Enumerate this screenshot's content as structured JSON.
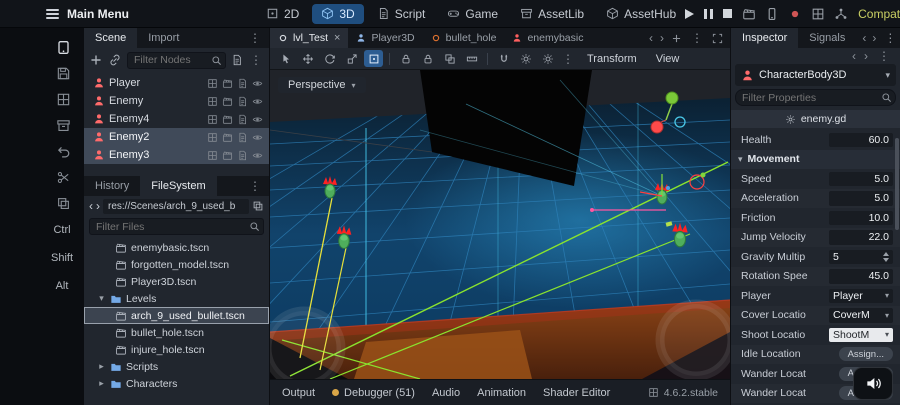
{
  "topbar": {
    "main_menu_label": "Main Menu",
    "workspaces": [
      {
        "label": "2D",
        "icon": "workspace-2d-icon",
        "active": false
      },
      {
        "label": "3D",
        "icon": "workspace-3d-icon",
        "active": true
      },
      {
        "label": "Script",
        "icon": "script-workspace-icon",
        "active": false
      },
      {
        "label": "Game",
        "icon": "gamepad-icon",
        "active": false
      },
      {
        "label": "AssetLib",
        "icon": "assetlib-icon",
        "active": false
      },
      {
        "label": "AssetHub",
        "icon": "assethub-icon",
        "active": false
      }
    ],
    "playback_icons": [
      "play-icon",
      "pause-icon",
      "stop-icon"
    ],
    "misc_icons": [
      "clapper-icon",
      "devices-icon",
      "remote-debug-icon",
      "grid-icon",
      "network-icon"
    ],
    "renderer": {
      "label": "Compatibility",
      "color": "#c9cf63"
    }
  },
  "shortcut_strip": {
    "icons": [
      "tablet-icon",
      "save-icon",
      "grid-icon",
      "archive-icon",
      "undo-icon",
      "scissors-icon",
      "copy-icon"
    ],
    "keys": [
      "Ctrl",
      "Shift",
      "Alt"
    ]
  },
  "scene_panel": {
    "tabs": [
      "Scene",
      "Import"
    ],
    "active_tab": "Scene",
    "filter_placeholder": "Filter Nodes",
    "nodes": [
      {
        "name": "Player",
        "selected": false
      },
      {
        "name": "Enemy",
        "selected": false
      },
      {
        "name": "Enemy4",
        "selected": false
      },
      {
        "name": "Enemy2",
        "selected": true
      },
      {
        "name": "Enemy3",
        "selected": true
      }
    ]
  },
  "filesystem": {
    "tabs": [
      "History",
      "FileSystem"
    ],
    "active_tab": "FileSystem",
    "path": "res://Scenes/arch_9_used_b",
    "filter_placeholder": "Filter Files",
    "entries": [
      {
        "name": "enemybasic.tscn",
        "kind": "scene",
        "depth": 2,
        "selected": false
      },
      {
        "name": "forgotten_model.tscn",
        "kind": "scene",
        "depth": 2,
        "selected": false
      },
      {
        "name": "Player3D.tscn",
        "kind": "scene",
        "depth": 2,
        "selected": false
      },
      {
        "name": "Levels",
        "kind": "folder",
        "depth": 1,
        "expanded": true,
        "selected": false
      },
      {
        "name": "arch_9_used_bullet.tscn",
        "kind": "scene",
        "depth": 2,
        "selected": true
      },
      {
        "name": "bullet_hole.tscn",
        "kind": "scene",
        "depth": 2,
        "selected": false
      },
      {
        "name": "injure_hole.tscn",
        "kind": "scene",
        "depth": 2,
        "selected": false
      },
      {
        "name": "Scripts",
        "kind": "folder",
        "depth": 1,
        "expanded": false,
        "selected": false
      },
      {
        "name": "Characters",
        "kind": "folder",
        "depth": 1,
        "expanded": false,
        "selected": false
      }
    ]
  },
  "main": {
    "scene_tabs": [
      {
        "label": "lvl_Test",
        "icon": "scene-root-icon",
        "icon_color": "#d8dce2",
        "active": true,
        "closable": true
      },
      {
        "label": "Player3D",
        "icon": "node-person-icon",
        "icon_color": "#8fb6e8",
        "active": false,
        "closable": false
      },
      {
        "label": "bullet_hole",
        "icon": "ring-icon",
        "icon_color": "#e0722f",
        "active": false,
        "closable": false
      },
      {
        "label": "enemybasic",
        "icon": "node-person-icon",
        "icon_color": "#ff5f5f",
        "active": false,
        "closable": false
      }
    ],
    "viewport_toolbar": {
      "tools": [
        "select-tool-icon",
        "move-tool-icon",
        "rotate-tool-icon",
        "scale-tool-icon",
        "transform-tool-icon"
      ],
      "active_tool_index": 4,
      "toggles": [
        "lock-icon",
        "unlock-icon",
        "group-icon",
        "ruler-icon"
      ],
      "view_toggles": [
        "snap-icon",
        "sun-icon",
        "environment-icon"
      ],
      "menus": [
        "Transform",
        "View"
      ]
    },
    "perspective_label": "Perspective",
    "bottom_bar": {
      "items": [
        {
          "label": "Output"
        },
        {
          "label": "Debugger (51)",
          "dot_color": "#d9a648"
        },
        {
          "label": "Audio"
        },
        {
          "label": "Animation"
        },
        {
          "label": "Shader Editor"
        }
      ],
      "version": "4.6.2.stable"
    }
  },
  "inspector": {
    "tabs": [
      "Inspector",
      "Signals"
    ],
    "active_tab": "Inspector",
    "node_name": "CharacterBody3D",
    "filter_placeholder": "Filter Properties",
    "script_name": "enemy.gd",
    "properties": [
      {
        "label": "Health",
        "value": "60.0",
        "kind": "number"
      },
      {
        "label": "Movement",
        "kind": "section"
      },
      {
        "label": "Speed",
        "value": "5.0",
        "kind": "number"
      },
      {
        "label": "Acceleration",
        "value": "5.0",
        "kind": "number"
      },
      {
        "label": "Friction",
        "value": "10.0",
        "kind": "number"
      },
      {
        "label": "Jump Velocity",
        "value": "22.0",
        "kind": "number"
      },
      {
        "label": "Gravity Multip",
        "value": "5",
        "kind": "spinner"
      },
      {
        "label": "Rotation Spee",
        "value": "45.0",
        "kind": "number"
      },
      {
        "label": "Player",
        "value": "Player",
        "kind": "dropdown",
        "light": false
      },
      {
        "label": "Cover Locatio",
        "value": "CoverM",
        "kind": "dropdown",
        "light": false
      },
      {
        "label": "Shoot Locatio",
        "value": "ShootM",
        "kind": "dropdown",
        "light": true
      },
      {
        "label": "Idle Location",
        "value": "Assign...",
        "kind": "assign"
      },
      {
        "label": "Wander Locat",
        "value": "Assign...",
        "kind": "assign"
      },
      {
        "label": "Wander Locat",
        "value": "Assign...",
        "kind": "assign"
      }
    ]
  },
  "overlay": {
    "volume_icon": "speaker-icon"
  }
}
